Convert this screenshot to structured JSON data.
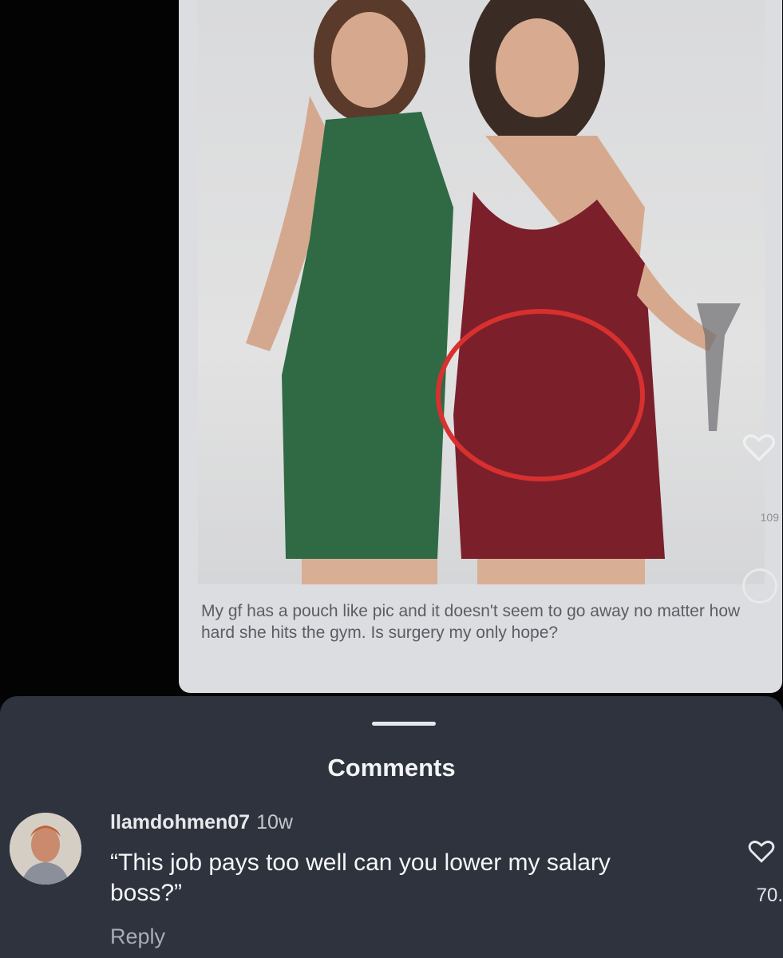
{
  "post": {
    "caption": "My gf has a pouch like pic and it doesn't seem to go away no matter how hard she hits the gym. Is surgery my only hope?",
    "like_count": "109",
    "icons": {
      "like": "heart-outline-icon",
      "action": "circle-icon"
    }
  },
  "comments_sheet": {
    "title": "Comments",
    "comment": {
      "username": "llamdohmen07",
      "age": "10w",
      "text": "“This job pays too well can you lower my salary boss?”",
      "reply_label": "Reply",
      "like_count": "70.",
      "icons": {
        "avatar": "avatar-photo",
        "like": "heart-outline-icon"
      }
    }
  },
  "colors": {
    "sheet_bg": "#2e333d",
    "card_bg": "#dcdde1",
    "highlight_circle": "#d8302f",
    "green_dress": "#2f6a44",
    "red_dress": "#7b1f2b"
  }
}
